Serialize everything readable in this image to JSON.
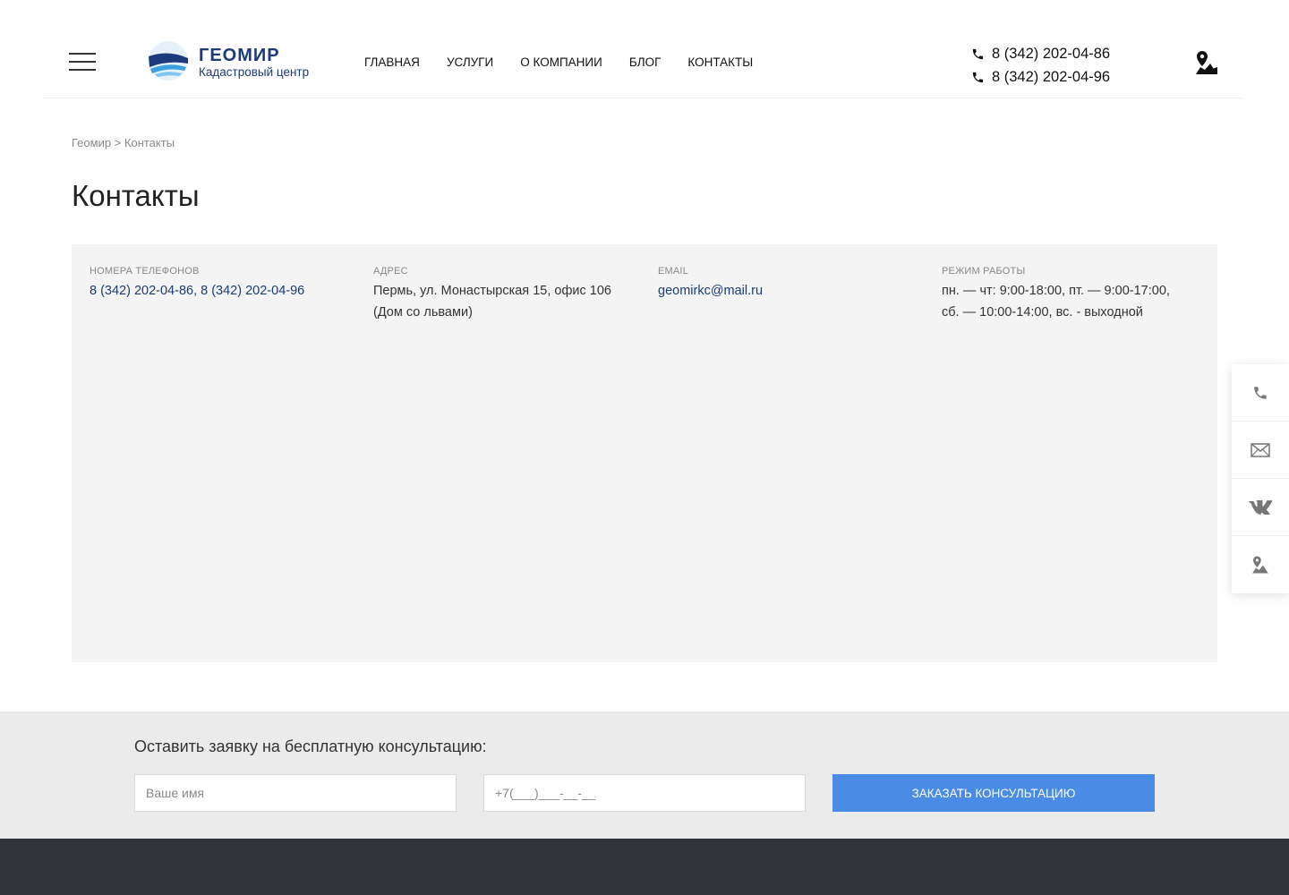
{
  "header": {
    "logo": {
      "name": "ГЕОМИР",
      "subtitle": "Кадастровый центр"
    },
    "nav": [
      "ГЛАВНАЯ",
      "УСЛУГИ",
      "О КОМПАНИИ",
      "БЛОГ",
      "КОНТАКТЫ"
    ],
    "phones": [
      "8 (342) 202-04-86",
      "8 (342) 202-04-96"
    ]
  },
  "breadcrumb": {
    "home": "Геомир",
    "separator": " > ",
    "current": "Контакты"
  },
  "page_title": "Контакты",
  "contacts": {
    "phones": {
      "label": "НОМЕРА ТЕЛЕФОНОВ",
      "value": "8 (342) 202-04-86, 8 (342) 202-04-96"
    },
    "address": {
      "label": "АДРЕС",
      "line1": "Пермь, ул. Монастырская 15, офис 106",
      "line2": "(Дом со львами)"
    },
    "email": {
      "label": "EMAIL",
      "value": "geomirkc@mail.ru"
    },
    "hours": {
      "label": "РЕЖИМ РАБОТЫ",
      "line1": "пн. — чт: 9:00-18:00, пт. — 9:00-17:00,",
      "line2": "сб. — 10:00-14:00, вс. - выходной"
    }
  },
  "side_panel": [
    "phone-icon",
    "mail-icon",
    "vk-icon",
    "map-icon"
  ],
  "consult": {
    "title": "Оставить заявку на бесплатную консультацию:",
    "name_placeholder": "Ваше имя",
    "phone_placeholder": "+7(___)___-__-__",
    "button": "ЗАКАЗАТЬ КОНСУЛЬТАЦИЮ"
  },
  "colors": {
    "brand": "#1d3a7a",
    "accent": "#4a8be6",
    "footer": "#303338",
    "panel": "#f4f4f4"
  }
}
